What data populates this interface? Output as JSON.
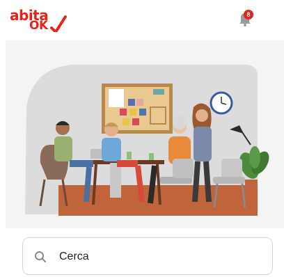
{
  "header": {
    "logo_line1": "abita",
    "logo_line2": "OK",
    "notification_count": "8"
  },
  "search": {
    "placeholder": "Cerca"
  },
  "colors": {
    "brand": "#e1251b",
    "hero_background": "#f4f4f4"
  },
  "icons": {
    "notifications": "bell-icon",
    "search": "search-icon",
    "logo_mark": "checkmark-icon"
  }
}
